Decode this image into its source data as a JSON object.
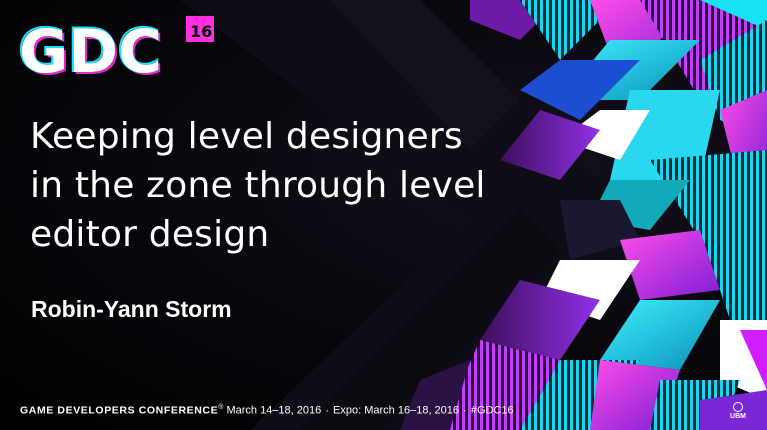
{
  "logo": {
    "text": "GDC",
    "badge": "16"
  },
  "title_lines": [
    "Keeping level designers",
    "in the zone through level",
    "editor design"
  ],
  "author": "Robin-Yann Storm",
  "footer": {
    "conference": "GAME DEVELOPERS CONFERENCE",
    "trademark": "®",
    "dates": "March 14–18, 2016",
    "separator": "·",
    "expo": "Expo: March 16–18, 2016",
    "hashtag": "#GDC16"
  },
  "sponsor_logo": {
    "text": "UBM"
  },
  "colors": {
    "magenta": "#d01cff",
    "purple": "#7a28d6",
    "cyan": "#18e3f2",
    "teal": "#10b8c8",
    "pink": "#ff5ee0",
    "white": "#ffffff",
    "background": "#050408"
  }
}
